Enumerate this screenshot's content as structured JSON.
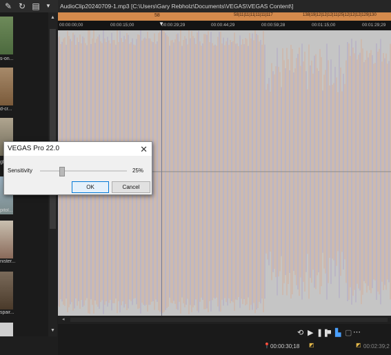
{
  "toolbar": {
    "icons": [
      "pin-icon",
      "refresh-icon",
      "view-icon",
      "dropdown-icon"
    ]
  },
  "thumbnails": [
    {
      "label": "s-on..."
    },
    {
      "label": "d-cr..."
    },
    {
      "label": "gh"
    },
    {
      "label": "pitol..."
    },
    {
      "label": "nister..."
    },
    {
      "label": "spair..."
    }
  ],
  "title": "AudioClip20240709-1.mp3    [C:\\Users\\Gary Rebholz\\Documents\\VEGAS\\VEGAS Content\\]",
  "markers": {
    "m58": "58",
    "cluster": "58|11|11|11|11|11|117",
    "cluster2": "138|19|12|12|12|11|25|12|12|12|129|130"
  },
  "ruler_ticks": [
    "00:00:00;00",
    "00:00:15;00",
    "00:00:29;29",
    "00:00:44;29",
    "00:00:59;28",
    "00:01:15;00",
    "00:01:29;29"
  ],
  "dialog": {
    "title": "VEGAS Pro 22.0",
    "sensitivity_label": "Sensitivity",
    "sensitivity_value": "25%",
    "sensitivity_level": 0.25,
    "ok_label": "OK",
    "cancel_label": "Cancel",
    "close_glyph": "✕"
  },
  "transport": {
    "cursor_time": "00:00:30;18",
    "end_time": "00:02:39;2"
  },
  "colors": {
    "marker_strip": "#d48a4c",
    "waveform_bg": "#c5c5c5",
    "wave_orange": "#d9a78a",
    "wave_purple": "#a79bc8",
    "accent": "#0078d7"
  }
}
